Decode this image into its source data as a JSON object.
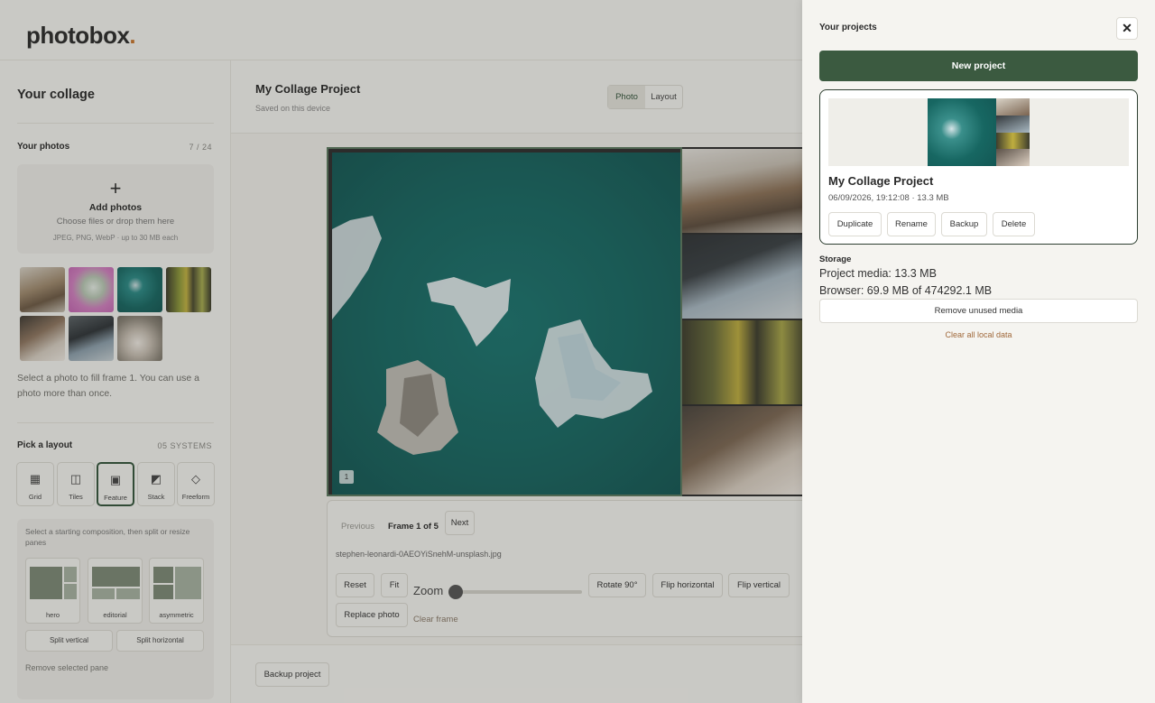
{
  "brand": {
    "name": "photobox",
    "dot": "."
  },
  "sidebar": {
    "title": "Your collage",
    "photos_label": "Your photos",
    "photos_count": "7 / 24",
    "dropzone": {
      "title": "Add photos",
      "subtitle": "Choose files or drop them here",
      "formats": "JPEG, PNG, WebP · up to 30 MB each"
    },
    "hint": "Select a photo to fill frame 1. You can use a photo more than once.",
    "layout_label": "Pick a layout",
    "layout_meta": "05 SYSTEMS",
    "layouts": [
      {
        "label": "Grid",
        "icon": "grid-icon"
      },
      {
        "label": "Tiles",
        "icon": "tiles-icon"
      },
      {
        "label": "Feature",
        "icon": "feature-icon",
        "selected": true
      },
      {
        "label": "Stack",
        "icon": "stack-icon"
      },
      {
        "label": "Freeform",
        "icon": "freeform-icon"
      }
    ],
    "composition_hint": "Select a starting composition, then split or resize panes",
    "compositions": [
      "hero",
      "editorial",
      "asymmetric"
    ],
    "split_vertical": "Split vertical",
    "split_horizontal": "Split horizontal",
    "remove_pane": "Remove selected pane"
  },
  "project": {
    "title": "My Collage Project",
    "saved": "Saved on this device",
    "view_tabs": [
      "Photo",
      "Layout"
    ],
    "frame_number": "1"
  },
  "frame_controls": {
    "previous": "Previous",
    "frame_label": "Frame 1 of 5",
    "next": "Next",
    "filename": "stephen-leonardi-0AEOYiSnehM-unsplash.jpg",
    "reset": "Reset",
    "fit": "Fit",
    "zoom_label": "Zoom",
    "zoom_level": 0,
    "rotate": "Rotate 90°",
    "flip_h": "Flip horizontal",
    "flip_v": "Flip vertical",
    "replace": "Replace photo",
    "clear": "Clear frame"
  },
  "footer": {
    "backup": "Backup project"
  },
  "drawer": {
    "title": "Your projects",
    "close_icon": "close-icon",
    "new_project": "New project",
    "card": {
      "name": "My Collage Project",
      "meta": "06/09/2026, 19:12:08 · 13.3 MB",
      "actions": [
        "Duplicate",
        "Rename",
        "Backup",
        "Delete"
      ]
    },
    "storage_title": "Storage",
    "project_media": "Project media: 13.3 MB",
    "browser": "Browser: 69.9 MB of 474292.1 MB",
    "remove_unused": "Remove unused media",
    "clear_all": "Clear all local data"
  },
  "colors": {
    "accent": "#3b5a40",
    "teal": "#176762",
    "link": "#a0683a"
  }
}
